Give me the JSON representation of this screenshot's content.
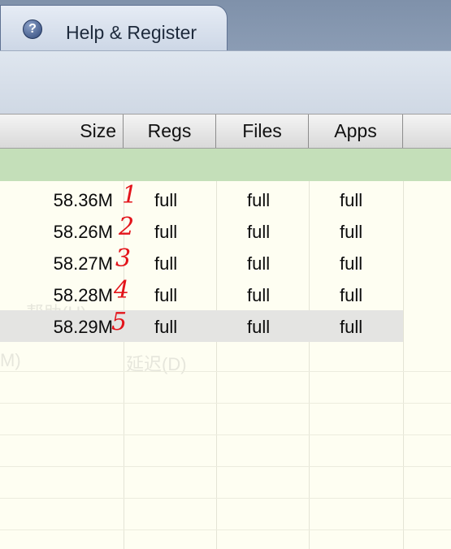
{
  "tab": {
    "label": "Help & Register",
    "icon": "help-icon"
  },
  "columns": {
    "size": "Size",
    "regs": "Regs",
    "files": "Files",
    "apps": "Apps"
  },
  "rows": [
    {
      "size": "58.36M",
      "regs": "full",
      "files": "full",
      "apps": "full",
      "mark": "1"
    },
    {
      "size": "58.26M",
      "regs": "full",
      "files": "full",
      "apps": "full",
      "mark": "2"
    },
    {
      "size": "58.27M",
      "regs": "full",
      "files": "full",
      "apps": "full",
      "mark": "3"
    },
    {
      "size": "58.28M",
      "regs": "full",
      "files": "full",
      "apps": "full",
      "mark": "4"
    },
    {
      "size": "58.29M",
      "regs": "full",
      "files": "full",
      "apps": "full",
      "mark": "5"
    }
  ],
  "background_ghost": {
    "menu_text": "帮助(H)",
    "toolbar_text": "M)",
    "delay_text": "延迟(D)"
  },
  "colors": {
    "annotation": "#e3141b",
    "group_row": "#c4dfb9",
    "grid_bg": "#fefef2"
  }
}
